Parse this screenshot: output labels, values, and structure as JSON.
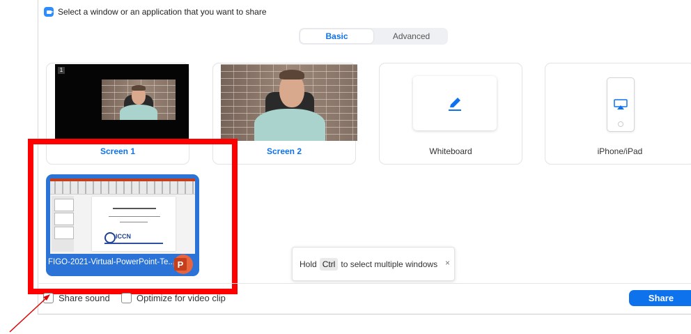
{
  "window": {
    "title": "Select a window or an application that you want to share",
    "icon": "zoom-camera-icon",
    "accent_color": "#0e72ed"
  },
  "tabs": [
    {
      "label": "Basic",
      "active": true
    },
    {
      "label": "Advanced",
      "active": false
    }
  ],
  "share_options": [
    {
      "label": "Screen 1",
      "badge": "1",
      "kind": "screen"
    },
    {
      "label": "Screen 2",
      "kind": "screen"
    },
    {
      "label": "Whiteboard",
      "icon": "pencil-icon"
    },
    {
      "label": "iPhone/iPad",
      "icon": "airplay-icon"
    }
  ],
  "windows": [
    {
      "title": "FIGO-2021-Virtual-PowerPoint-Te...",
      "app_icon": "powerpoint-icon",
      "app_letter": "P",
      "slide_logo_text": "ICCN",
      "selected": true
    }
  ],
  "tooltip": {
    "prefix": "Hold",
    "key": "Ctrl",
    "suffix": "to select multiple windows",
    "close": "×"
  },
  "footer": {
    "share_sound": {
      "label": "Share sound",
      "checked": false
    },
    "optimize_video": {
      "label": "Optimize for video clip",
      "checked": false
    },
    "share_button": "Share"
  },
  "annotation": {
    "highlight_color": "#ff0000"
  }
}
